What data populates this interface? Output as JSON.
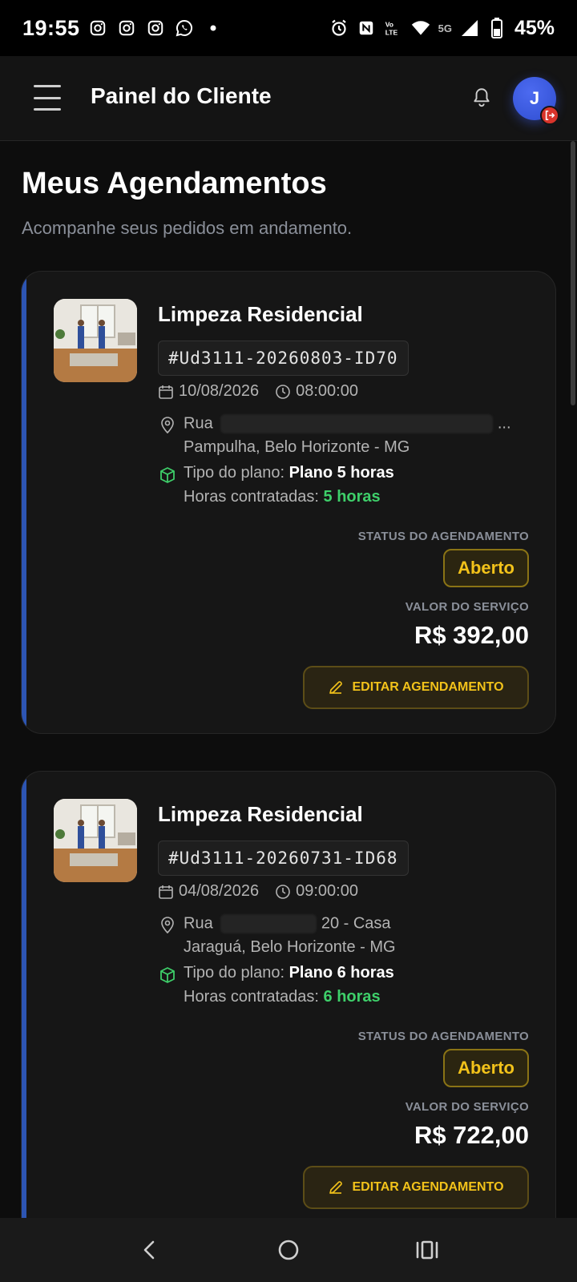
{
  "status_bar": {
    "time": "19:55",
    "left_icons": [
      "instagram-icon",
      "instagram-icon",
      "instagram-icon",
      "whatsapp-icon",
      "dot-icon"
    ],
    "right_icons": [
      "alarm-icon",
      "nfc-icon",
      "volte-icon",
      "wifi-icon",
      "5g-icon",
      "signal-icon",
      "battery-icon"
    ],
    "network": "5G",
    "battery": "45%"
  },
  "header": {
    "title": "Painel do Cliente",
    "avatar_initial": "J"
  },
  "page": {
    "title": "Meus Agendamentos",
    "subtitle": "Acompanhe seus pedidos em andamento."
  },
  "labels": {
    "plan_type": "Tipo do plano: ",
    "hours_contracted": "Horas contratadas: ",
    "status": "STATUS DO AGENDAMENTO",
    "value": "VALOR DO SERVIÇO",
    "edit": "EDITAR AGENDAMENTO"
  },
  "bookings": [
    {
      "service": "Limpeza Residencial",
      "code": "#Ud3111-20260803-ID70",
      "date": "10/08/2026",
      "time": "08:00:00",
      "street": "Rua",
      "street_tail": "...",
      "neighborhood": "Pampulha, Belo Horizonte - MG",
      "plan": "Plano 5 horas",
      "hours": "5 horas",
      "status": "Aberto",
      "price": "R$ 392,00"
    },
    {
      "service": "Limpeza Residencial",
      "code": "#Ud3111-20260731-ID68",
      "date": "04/08/2026",
      "time": "09:00:00",
      "street": "Rua",
      "street_tail": "20 - Casa",
      "neighborhood": "Jaraguá, Belo Horizonte - MG",
      "plan": "Plano 6 horas",
      "hours": "6 horas",
      "status": "Aberto",
      "price": "R$ 722,00"
    }
  ],
  "colors": {
    "accent_bar": "#2d55b3",
    "status_yellow": "#f2c21a",
    "hours_green": "#3ecf6a",
    "avatar_blue": "#3b5be0"
  }
}
